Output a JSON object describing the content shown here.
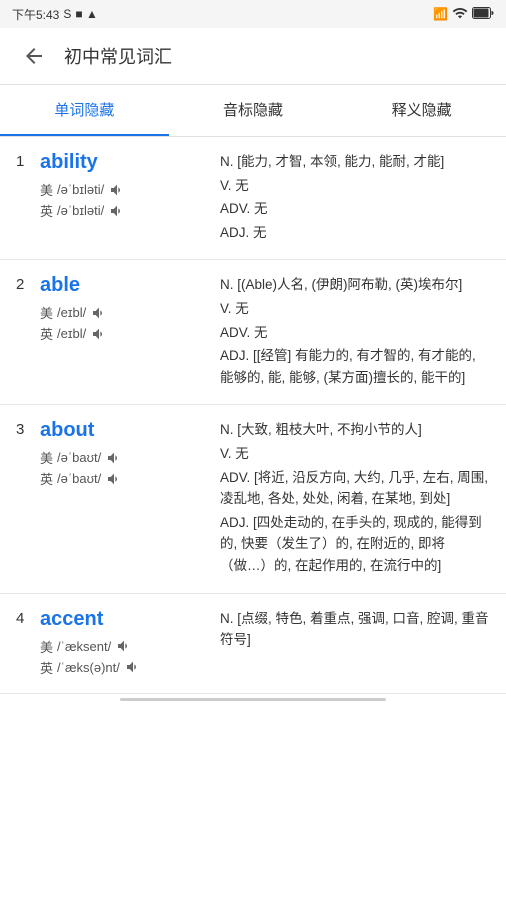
{
  "status_bar": {
    "time": "下午5:43",
    "icons_left": "S",
    "icons_right": "信号 WiFi 电池"
  },
  "header": {
    "back_label": "返回",
    "title": "初中常见词汇"
  },
  "tabs": [
    {
      "id": "word",
      "label": "单词隐藏",
      "active": true
    },
    {
      "id": "phonetic",
      "label": "音标隐藏",
      "active": false
    },
    {
      "id": "meaning",
      "label": "释义隐藏",
      "active": false
    }
  ],
  "words": [
    {
      "num": "1",
      "word": "ability",
      "phonetics": [
        {
          "region": "美",
          "text": "/əˈbɪləti/"
        },
        {
          "region": "英",
          "text": "/əˈbɪləti/"
        }
      ],
      "definitions": [
        {
          "pos": "N.",
          "text": "[能力, 才智, 本领, 能力, 能耐, 才能]"
        },
        {
          "pos": "V.",
          "text": "无"
        },
        {
          "pos": "ADV.",
          "text": "无"
        },
        {
          "pos": "ADJ.",
          "text": "无"
        }
      ]
    },
    {
      "num": "2",
      "word": "able",
      "phonetics": [
        {
          "region": "美",
          "text": "/eɪbl/"
        },
        {
          "region": "英",
          "text": "/eɪbl/"
        }
      ],
      "definitions": [
        {
          "pos": "N.",
          "text": "[(Able)人名, (伊朗)阿布勒, (英)埃布尔]"
        },
        {
          "pos": "V.",
          "text": "无"
        },
        {
          "pos": "ADV.",
          "text": "无"
        },
        {
          "pos": "ADJ.",
          "text": "[[经管] 有能力的, 有才智的, 有才能的, 能够的, 能, 能够, (某方面)擅长的, 能干的]"
        }
      ]
    },
    {
      "num": "3",
      "word": "about",
      "phonetics": [
        {
          "region": "美",
          "text": "/əˈbaʊt/"
        },
        {
          "region": "英",
          "text": "/əˈbaʊt/"
        }
      ],
      "definitions": [
        {
          "pos": "N.",
          "text": "[大致, 粗枝大叶, 不拘小节的人]"
        },
        {
          "pos": "V.",
          "text": "无"
        },
        {
          "pos": "ADV.",
          "text": "[将近, 沿反方向, 大约, 几乎, 左右, 周围, 凌乱地, 各处, 处处, 闲着, 在某地, 到处]"
        },
        {
          "pos": "ADJ.",
          "text": "[四处走动的, 在手头的, 现成的, 能得到的, 快要（发生了）的, 在附近的, 即将（做…）的, 在起作用的, 在流行中的]"
        }
      ]
    },
    {
      "num": "4",
      "word": "accent",
      "phonetics": [
        {
          "region": "美",
          "text": "/ˈæksent/"
        },
        {
          "region": "英",
          "text": "/ˈæks(ə)nt/"
        }
      ],
      "definitions": [
        {
          "pos": "N.",
          "text": "[点缀, 特色, 着重点, 强调, 口音, 腔调, 重音符号]"
        }
      ]
    }
  ]
}
